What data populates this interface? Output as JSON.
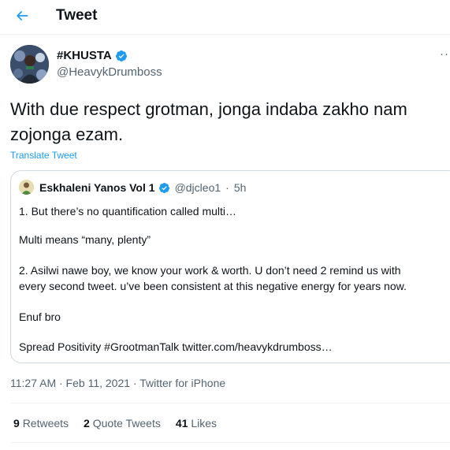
{
  "header": {
    "title": "Tweet"
  },
  "author": {
    "name": "#KHUSTA",
    "handle": "@HeavykDrumboss",
    "verified": true
  },
  "tweet": {
    "text": "With due respect grotman, jonga indaba zakho nam zojonga ezam.",
    "translate_label": "Translate Tweet",
    "timestamp": "11:27 AM · Feb 11, 2021 · Twitter for iPhone"
  },
  "quoted": {
    "name": "Eskhaleni Yanos Vol 1",
    "handle": "@djcleo1",
    "age": "5h",
    "lines": [
      "1. But there’s no quantification called multi…",
      "Multi means “many, plenty”",
      "2. Asilwi nawe boy, we know your work & worth. U don’t need 2 remind us with",
      "every second tweet. u’ve been consistent at this negative energy for years now.",
      "Enuf bro",
      "Spread Positivity #GrootmanTalk twitter.com/heavykdrumboss…"
    ]
  },
  "stats": {
    "retweets_count": "9",
    "retweets_label": "Retweets",
    "quotes_count": "2",
    "quotes_label": "Quote Tweets",
    "likes_count": "41",
    "likes_label": "Likes"
  },
  "colors": {
    "accent": "#1d9bf0",
    "secondary_text": "#536471",
    "border": "#cfd9de"
  },
  "icons": [
    "back-arrow-icon",
    "verified-badge-icon",
    "more-options-icon"
  ]
}
